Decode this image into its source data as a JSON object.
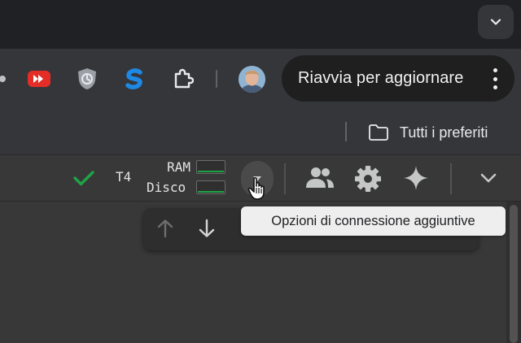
{
  "browser": {
    "update_button_label": "Riavvia per aggiornare",
    "extensions": [
      "youtube-extension",
      "shield-extension",
      "s-extension",
      "extensions-puzzle"
    ]
  },
  "bookmarks_bar": {
    "all_bookmarks_label": "Tutti i preferiti"
  },
  "colab_header": {
    "runtime_label": "T4",
    "ram_label": "RAM",
    "disk_label": "Disco",
    "connected": true,
    "accent_green": "#1ea446"
  },
  "tooltip": {
    "text": "Opzioni di connessione aggiuntive"
  },
  "colors": {
    "tabstrip": "#202124",
    "toolbar": "#35363a",
    "colab_bg": "#383838",
    "tooltip_bg": "#eeeeee",
    "youtube_red": "#e52d27",
    "s_blue": "#1e88e5"
  }
}
